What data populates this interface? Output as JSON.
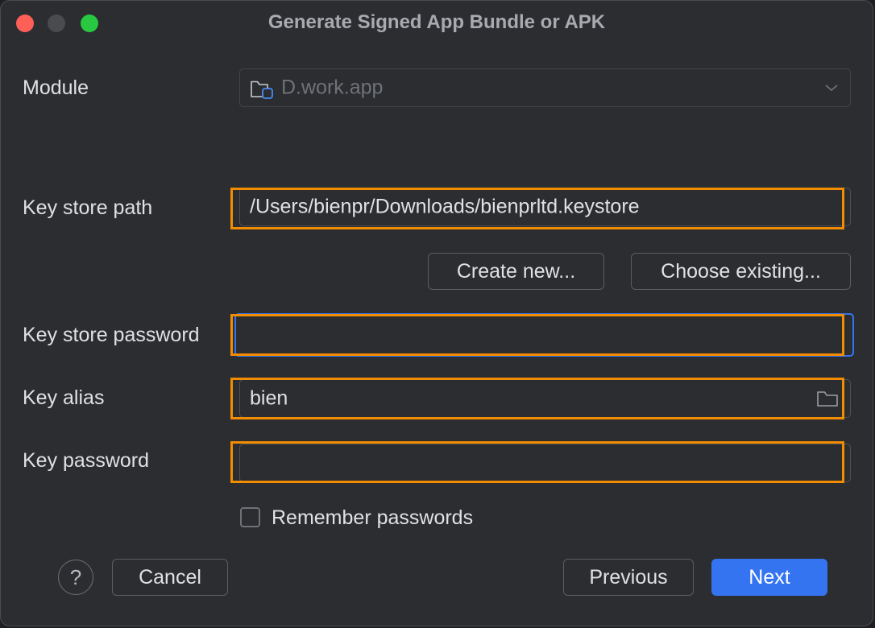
{
  "window": {
    "title": "Generate Signed App Bundle or APK"
  },
  "module": {
    "label": "Module",
    "value": "D.work.app"
  },
  "keystore": {
    "path_label": "Key store path",
    "path_value": "/Users/bienpr/Downloads/bienprltd.keystore",
    "create_new": "Create new...",
    "choose_existing": "Choose existing...",
    "password_label": "Key store password",
    "password_value": ""
  },
  "key": {
    "alias_label": "Key alias",
    "alias_value": "bien",
    "password_label": "Key password",
    "password_value": ""
  },
  "remember": {
    "label": "Remember passwords",
    "checked": false
  },
  "footer": {
    "help": "?",
    "cancel": "Cancel",
    "previous": "Previous",
    "next": "Next"
  },
  "colors": {
    "highlight": "#f28c00",
    "primary": "#3574f0",
    "focus": "#3574f0"
  }
}
